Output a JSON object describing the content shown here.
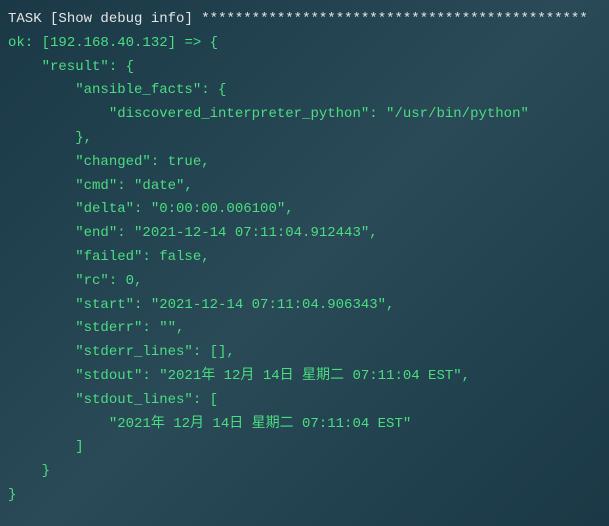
{
  "task": {
    "prefix": "TASK [",
    "name": "Show debug info",
    "suffix": "] ",
    "stars": "**********************************************"
  },
  "output": {
    "ok_prefix": "ok: [",
    "host": "192.168.40.132",
    "ok_suffix": "] => {",
    "result_key": "    \"result\": {",
    "ansible_facts_key": "        \"ansible_facts\": {",
    "discovered_key": "            \"discovered_interpreter_python\": \"/usr/bin/python\"",
    "close_facts": "        },",
    "changed": "        \"changed\": true,",
    "cmd": "        \"cmd\": \"date\",",
    "delta": "        \"delta\": \"0:00:00.006100\",",
    "end": "        \"end\": \"2021-12-14 07:11:04.912443\",",
    "failed": "        \"failed\": false,",
    "rc": "        \"rc\": 0,",
    "start": "        \"start\": \"2021-12-14 07:11:04.906343\",",
    "stderr": "        \"stderr\": \"\",",
    "stderr_lines": "        \"stderr_lines\": [],",
    "stdout": "        \"stdout\": \"2021年 12月 14日 星期二 07:11:04 EST\",",
    "stdout_lines_key": "        \"stdout_lines\": [",
    "stdout_line_0": "            \"2021年 12月 14日 星期二 07:11:04 EST\"",
    "close_stdout_lines": "        ]",
    "close_result": "    }",
    "close_root": "}"
  }
}
